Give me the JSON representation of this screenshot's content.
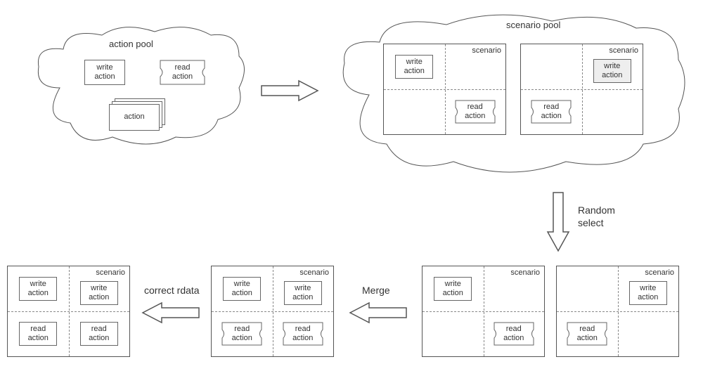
{
  "clouds": {
    "action_pool": "action pool",
    "scenario_pool": "scenario pool"
  },
  "boxes": {
    "write_action": "write\naction",
    "read_action": "read\naction",
    "action": "action",
    "scenario": "scenario"
  },
  "arrows": {
    "to_scenario_pool": "",
    "random_select": "Random\nselect",
    "merge": "Merge",
    "correct_rdata": "correct rdata"
  }
}
